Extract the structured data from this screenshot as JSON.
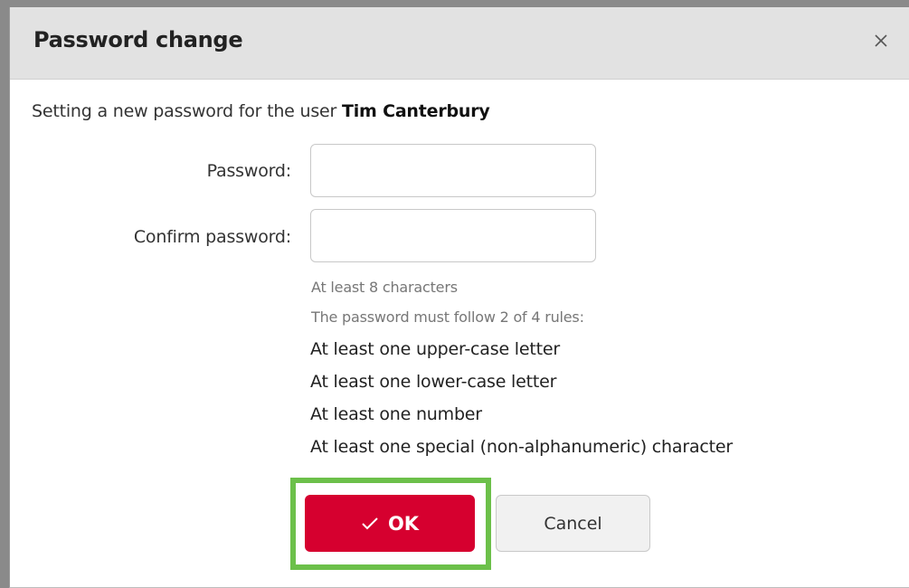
{
  "dialog": {
    "title": "Password change",
    "close_icon": "close-icon",
    "intro_prefix": "Setting a new password for the user ",
    "user_name": "Tim Canterbury"
  },
  "form": {
    "password_label": "Password:",
    "password_value": "",
    "confirm_label": "Confirm password:",
    "confirm_value": ""
  },
  "hints": {
    "min_length": "At least 8 characters",
    "rules_intro": "The password must follow 2 of 4 rules:",
    "rules": [
      "At least one upper-case letter",
      "At least one lower-case letter",
      "At least one number",
      "At least one special (non-alphanumeric) character"
    ]
  },
  "buttons": {
    "ok_label": "OK",
    "ok_icon": "checkmark-icon",
    "cancel_label": "Cancel"
  },
  "colors": {
    "primary": "#d6002f",
    "highlight": "#6cc04a",
    "title_bar": "#e2e2e2"
  }
}
